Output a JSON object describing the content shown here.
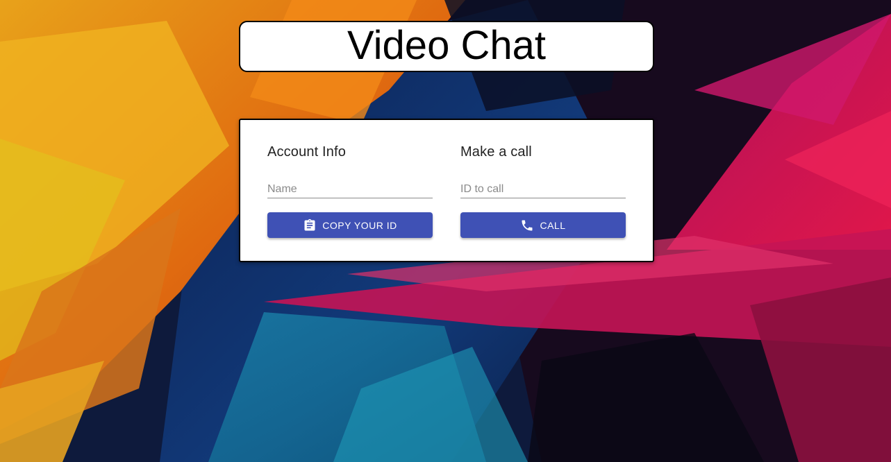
{
  "header": {
    "title": "Video Chat"
  },
  "account": {
    "heading": "Account Info",
    "name_placeholder": "Name",
    "name_value": "",
    "copy_button_label": "COPY YOUR ID",
    "copy_button_icon": "clipboard-icon"
  },
  "call": {
    "heading": "Make a call",
    "id_placeholder": "ID to call",
    "id_value": "",
    "call_button_label": "CALL",
    "call_button_icon": "phone-icon"
  },
  "colors": {
    "button": "#3f51b5",
    "card": "#ffffff",
    "border": "#000000"
  }
}
